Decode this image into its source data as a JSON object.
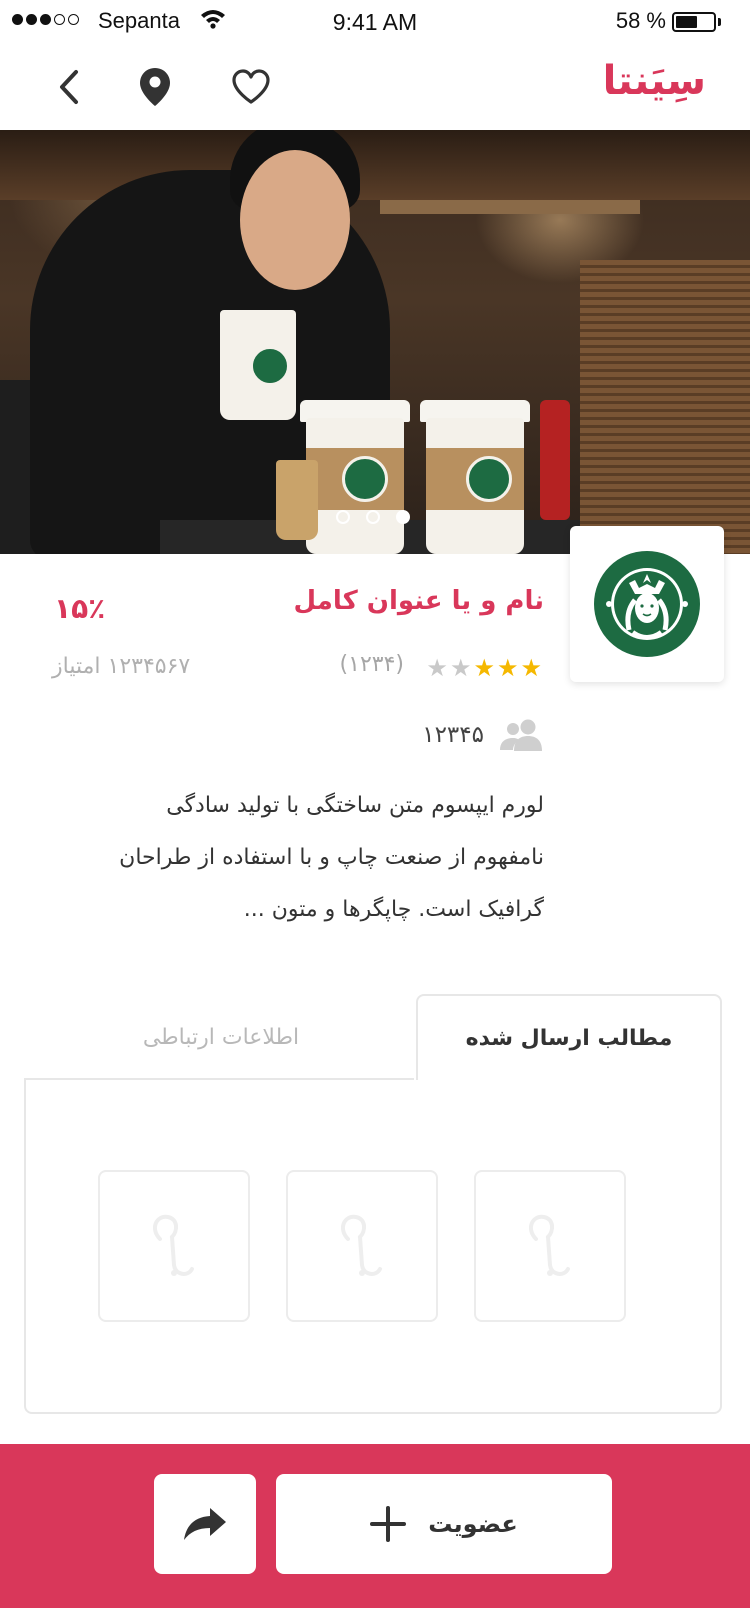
{
  "status_bar": {
    "carrier": "Sepanta",
    "time": "9:41 AM",
    "battery": "58 %",
    "battery_level": 0.58
  },
  "nav": {
    "logo": "سِیَنتا",
    "icons": [
      "chevron-left-icon",
      "location-pin-icon",
      "heart-icon"
    ]
  },
  "hero": {
    "slide_count": 3,
    "active_slide": 3
  },
  "business": {
    "title": "نام و یا عنوان کامل",
    "discount": "۱۵٪",
    "rating": 3,
    "rating_max": 5,
    "rating_count": "(۱۲۳۴)",
    "points": "۱۲۳۴۵۶۷ امتیاز",
    "members": "۱۲۳۴۵",
    "description_lines": [
      "لورم ایپسوم متن ساختگی با تولید سادگی",
      "نامفهوم از صنعت چاپ و با استفاده از طراحان",
      "گرافیک است. چاپگرها و متون  ..."
    ]
  },
  "tabs": {
    "active": "مطالب ارسال شده",
    "inactive": "اطلاعات ارتباطی"
  },
  "bottom_bar": {
    "join_label": "عضویت"
  },
  "colors": {
    "accent": "#d9375a",
    "star": "#f5b800",
    "starbucks_green": "#1d6b42"
  }
}
